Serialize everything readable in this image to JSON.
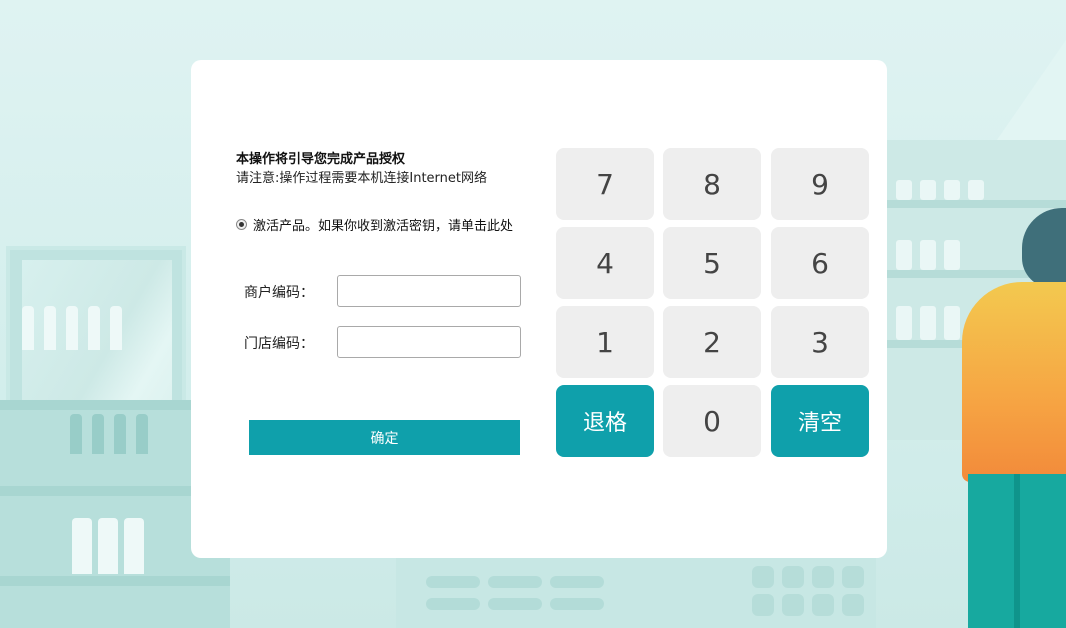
{
  "colors": {
    "accent": "#0fa0ab",
    "key_bg": "#eeeeee",
    "card_bg": "#ffffff",
    "background": "#d6efee"
  },
  "intro": {
    "title": "本操作将引导您完成产品授权",
    "note": "请注意:操作过程需要本机连接Internet网络"
  },
  "activation": {
    "radio_label": "激活产品。如果你收到激活密钥，请单击此处",
    "selected": true
  },
  "form": {
    "merchant_label": "商户编码：",
    "merchant_value": "",
    "store_label": "门店编码：",
    "store_value": "",
    "confirm_label": "确定"
  },
  "keypad": {
    "keys": [
      "7",
      "8",
      "9",
      "4",
      "5",
      "6",
      "1",
      "2",
      "3"
    ],
    "backspace": "退格",
    "zero": "0",
    "clear": "清空"
  }
}
